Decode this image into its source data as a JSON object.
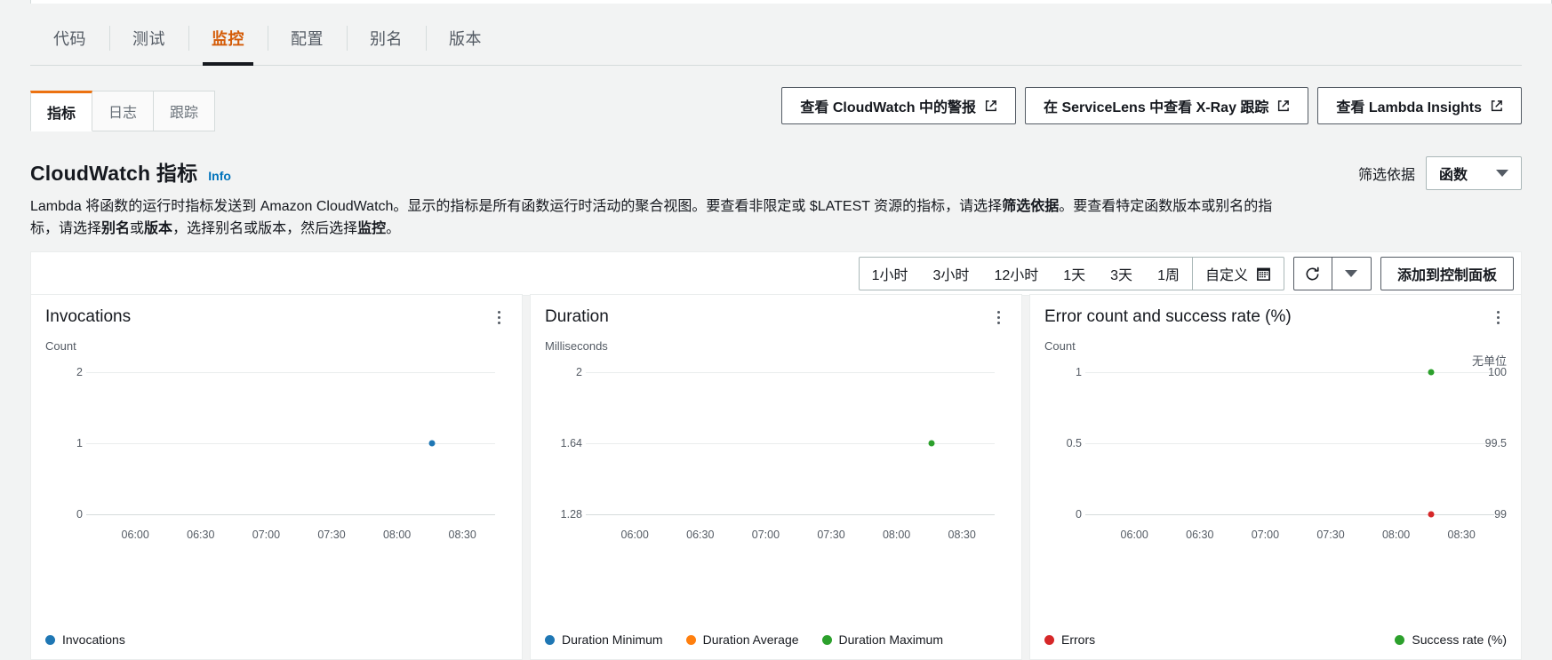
{
  "main_tabs": [
    {
      "label": "代码",
      "active": false
    },
    {
      "label": "测试",
      "active": false
    },
    {
      "label": "监控",
      "active": true
    },
    {
      "label": "配置",
      "active": false
    },
    {
      "label": "别名",
      "active": false
    },
    {
      "label": "版本",
      "active": false
    }
  ],
  "sub_tabs": [
    {
      "label": "指标",
      "active": true
    },
    {
      "label": "日志",
      "active": false
    },
    {
      "label": "跟踪",
      "active": false
    }
  ],
  "header_actions": [
    {
      "label": "查看 CloudWatch 中的警报",
      "icon": "external-link-icon"
    },
    {
      "label": "在 ServiceLens 中查看 X-Ray 跟踪",
      "icon": "external-link-icon"
    },
    {
      "label": "查看 Lambda Insights",
      "icon": "external-link-icon"
    }
  ],
  "section": {
    "title": "CloudWatch 指标",
    "info_label": "Info",
    "description_parts": [
      {
        "text": "Lambda 将函数的运行时指标发送到 Amazon CloudWatch。显示的指标是所有函数运行时活动的聚合视图。要查看非限定或 $LATEST 资源的指标，请选择",
        "bold": false
      },
      {
        "text": "筛选依据",
        "bold": true
      },
      {
        "text": "。要查看特定函数版本或别名的指标，请选择",
        "bold": false
      },
      {
        "text": "别名",
        "bold": true
      },
      {
        "text": "或",
        "bold": false
      },
      {
        "text": "版本",
        "bold": true
      },
      {
        "text": "，选择别名或版本，然后选择",
        "bold": false
      },
      {
        "text": "监控",
        "bold": true
      },
      {
        "text": "。",
        "bold": false
      }
    ]
  },
  "filter": {
    "label": "筛选依据",
    "selected": "函数",
    "icon": "chevron-down-icon"
  },
  "toolbar": {
    "ranges": [
      {
        "label": "1小时",
        "active": false
      },
      {
        "label": "3小时",
        "active": false
      },
      {
        "label": "12小时",
        "active": false
      },
      {
        "label": "1天",
        "active": false
      },
      {
        "label": "3天",
        "active": false
      },
      {
        "label": "1周",
        "active": false
      }
    ],
    "custom_label": "自定义",
    "custom_icon": "calendar-icon",
    "refresh_icon": "refresh-icon",
    "refresh_caret_icon": "chevron-down-icon",
    "add_to_dashboard": "添加到控制面板"
  },
  "colors": {
    "blue": "#1f77b4",
    "orange": "#ff7f0e",
    "green": "#2ca02c",
    "red": "#d62728",
    "accent": "#ec7211",
    "link": "#0073bb"
  },
  "chart_data": [
    {
      "type": "scatter",
      "title": "Invocations",
      "ylabel": "Count",
      "ylim": [
        0,
        2
      ],
      "yticks": [
        "2",
        "1",
        "0"
      ],
      "ytick_values": [
        2,
        1,
        0
      ],
      "xlabel": "",
      "xticks": [
        "06:00",
        "06:30",
        "07:00",
        "07:30",
        "08:00",
        "08:30"
      ],
      "grid": true,
      "legend_position": "bottom-left",
      "series": [
        {
          "name": "Invocations",
          "color": "#1f77b4",
          "points": [
            {
              "x": "08:10",
              "y": 1
            }
          ]
        }
      ]
    },
    {
      "type": "scatter",
      "title": "Duration",
      "ylabel": "Milliseconds",
      "ylim": [
        1.28,
        2
      ],
      "yticks": [
        "2",
        "1.64",
        "1.28"
      ],
      "ytick_values": [
        2,
        1.64,
        1.28
      ],
      "xlabel": "",
      "xticks": [
        "06:00",
        "06:30",
        "07:00",
        "07:30",
        "08:00",
        "08:30"
      ],
      "grid": true,
      "legend_position": "bottom-left",
      "series": [
        {
          "name": "Duration Minimum",
          "color": "#1f77b4",
          "points": []
        },
        {
          "name": "Duration Average",
          "color": "#ff7f0e",
          "points": []
        },
        {
          "name": "Duration Maximum",
          "color": "#2ca02c",
          "points": [
            {
              "x": "08:10",
              "y": 1.64
            }
          ]
        }
      ]
    },
    {
      "type": "scatter",
      "title": "Error count and success rate (%)",
      "ylabel": "Count",
      "ylabel_right": "无单位",
      "ylim": [
        0,
        1
      ],
      "yticks": [
        "1",
        "0.5",
        "0"
      ],
      "ytick_values": [
        1,
        0.5,
        0
      ],
      "yticks_right": [
        "100",
        "99.5",
        "99"
      ],
      "ylim_right": [
        99,
        100
      ],
      "xlabel": "",
      "xticks": [
        "06:00",
        "06:30",
        "07:00",
        "07:30",
        "08:00",
        "08:30"
      ],
      "grid": true,
      "legend_position": "bottom-spread",
      "series": [
        {
          "name": "Errors",
          "color": "#d62728",
          "points": [
            {
              "x": "08:10",
              "y": 0
            }
          ]
        },
        {
          "name": "Success rate (%)",
          "color": "#2ca02c",
          "points": [
            {
              "x": "08:10",
              "y": 100
            }
          ]
        }
      ]
    }
  ]
}
